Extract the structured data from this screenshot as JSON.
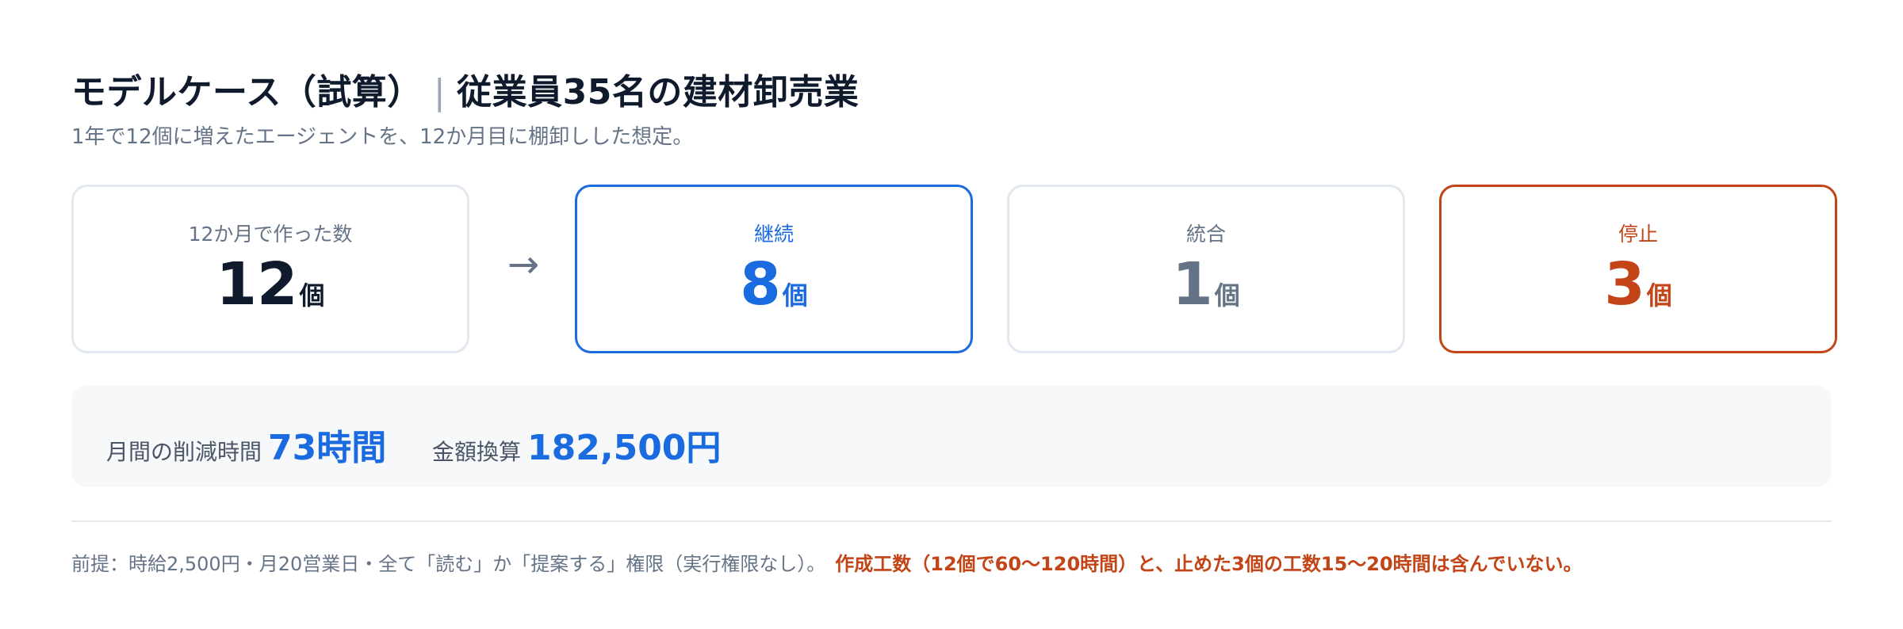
{
  "header": {
    "title_main": "モデルケース（試算）",
    "title_sep": "|",
    "title_sub": "従業員35名の建材卸売業",
    "subtitle": "1年で12個に増えたエージェントを、12か月目に棚卸しした想定。"
  },
  "cards": {
    "made": {
      "label": "12か月で作った数",
      "value": "12",
      "unit": "個"
    },
    "arrow": "→",
    "continue": {
      "label": "継続",
      "value": "8",
      "unit": "個"
    },
    "merge": {
      "label": "統合",
      "value": "1",
      "unit": "個"
    },
    "stop": {
      "label": "停止",
      "value": "3",
      "unit": "個"
    }
  },
  "savings": {
    "time_label": "月間の削減時間",
    "time_value": "73時間",
    "money_label": "金額換算",
    "money_value": "182,500円"
  },
  "footnote": {
    "premise": "前提：時給2,500円・月20営業日・全て「読む」か「提案する」権限（実行権限なし）。",
    "warning": "作成工数（12個で60〜120時間）と、止めた3個の工数15〜20時間は含んでいない。"
  },
  "colors": {
    "accent_blue": "#1a6ae0",
    "accent_red": "#c24417",
    "text_dark": "#0f1b2d",
    "text_muted": "#647386"
  }
}
